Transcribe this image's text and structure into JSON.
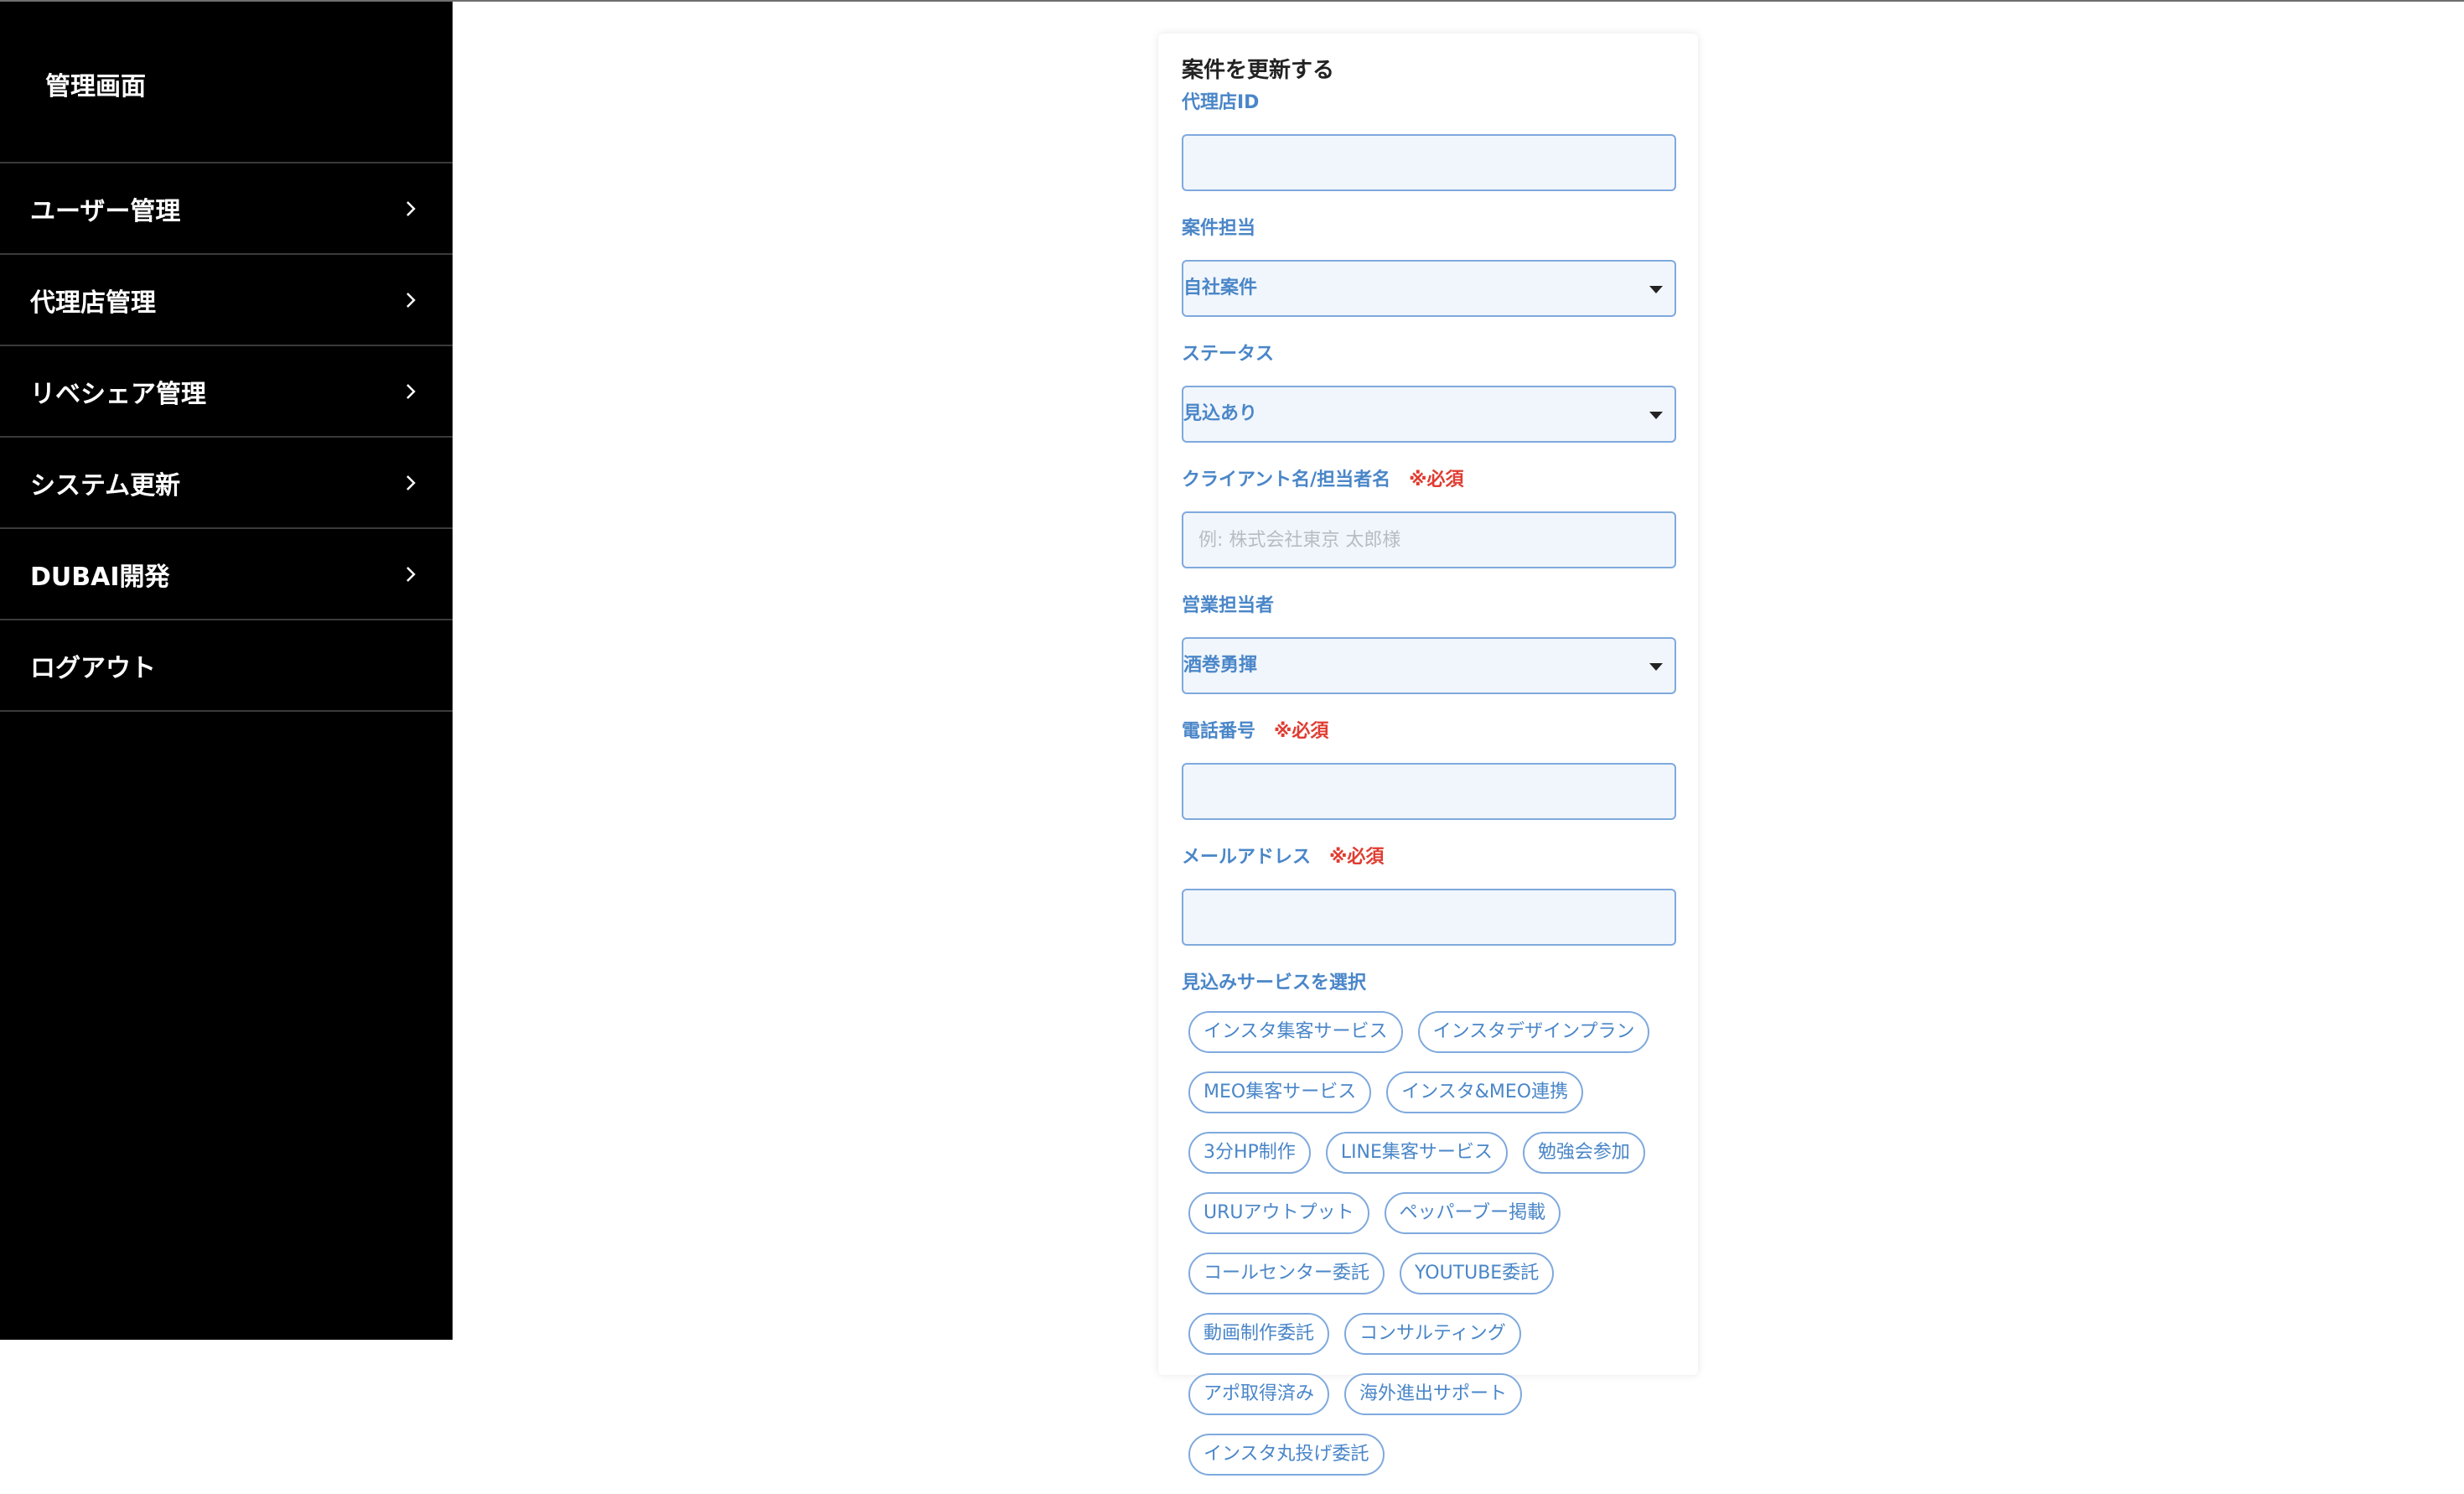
{
  "sidebar": {
    "title": "管理画面",
    "items": [
      {
        "label": "ユーザー管理",
        "has_chevron": true
      },
      {
        "label": "代理店管理",
        "has_chevron": true
      },
      {
        "label": "リベシェア管理",
        "has_chevron": true
      },
      {
        "label": "システム更新",
        "has_chevron": true
      },
      {
        "label": "DUBAI開発",
        "has_chevron": true
      },
      {
        "label": "ログアウト",
        "has_chevron": false
      }
    ]
  },
  "form": {
    "title": "案件を更新する",
    "agency_id": {
      "label": "代理店ID",
      "value": ""
    },
    "case_owner": {
      "label": "案件担当",
      "selected": "自社案件"
    },
    "status": {
      "label": "ステータス",
      "selected": "見込あり"
    },
    "client_name": {
      "label": "クライアント名/担当者名",
      "required": "※必須",
      "placeholder": "例: 株式会社東京 太郎様",
      "value": ""
    },
    "sales_rep": {
      "label": "営業担当者",
      "selected": "酒巻勇揮"
    },
    "phone": {
      "label": "電話番号",
      "required": "※必須",
      "value": ""
    },
    "email": {
      "label": "メールアドレス",
      "required": "※必須",
      "value": ""
    },
    "services": {
      "label": "見込みサービスを選択",
      "options": [
        "インスタ集客サービス",
        "インスタデザインプラン",
        "MEO集客サービス",
        "インスタ&MEO連携",
        "3分HP制作",
        "LINE集客サービス",
        "勉強会参加",
        "URUアウトプット",
        "ペッパーブー掲載",
        "コールセンター委託",
        "YOUTUBE委託",
        "動画制作委託",
        "コンサルティング",
        "アポ取得済み",
        "海外進出サポート",
        "インスタ丸投げ委託"
      ]
    }
  },
  "colors": {
    "sidebar_bg": "#000000",
    "label_blue": "#4a86c8",
    "required_red": "#e03c31",
    "field_bg": "#f1f6fc",
    "field_border": "#7fa9dd"
  },
  "icons": {
    "nav_chevron": "chevron-right-icon",
    "select_caret": "caret-down-icon"
  }
}
